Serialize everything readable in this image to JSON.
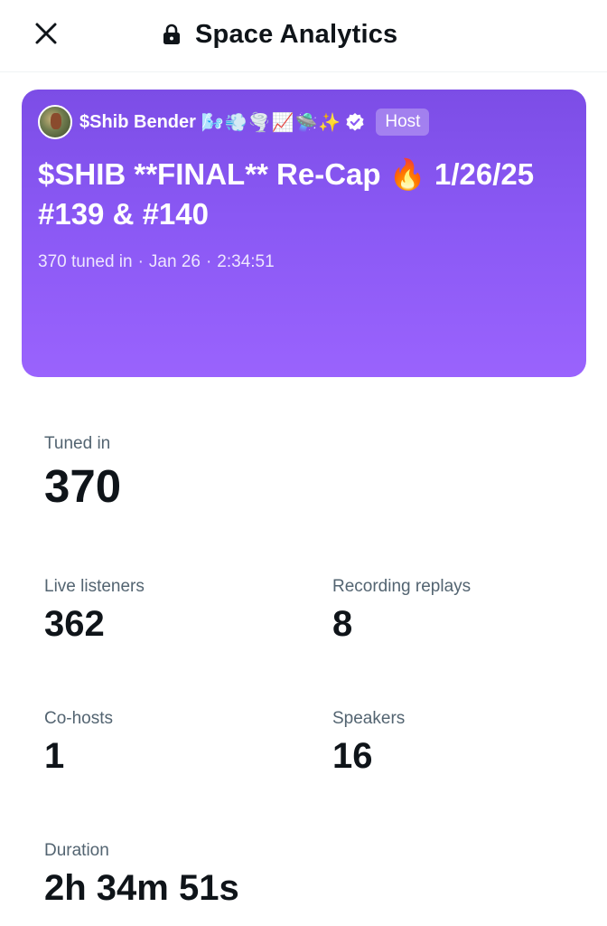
{
  "header": {
    "title": "Space Analytics",
    "close_icon": "close-icon",
    "lock_icon": "lock-icon"
  },
  "space": {
    "host_name": "$Shib Bender",
    "host_emojis": "🌬️💨🌪️📈🛸✨",
    "host_badge": "Host",
    "title": "$SHIB **FINAL** Re-Cap 🔥 1/26/25 #139 & #140",
    "tuned_in_text": "370 tuned in",
    "date": "Jan 26",
    "duration_text": "2:34:51",
    "card_color": "#8a58f4"
  },
  "stats": {
    "tuned_in": {
      "label": "Tuned in",
      "value": "370"
    },
    "live_listeners": {
      "label": "Live listeners",
      "value": "362"
    },
    "recording_replays": {
      "label": "Recording replays",
      "value": "8"
    },
    "co_hosts": {
      "label": "Co-hosts",
      "value": "1"
    },
    "speakers": {
      "label": "Speakers",
      "value": "16"
    },
    "duration": {
      "label": "Duration",
      "value": "2h 34m 51s"
    }
  }
}
